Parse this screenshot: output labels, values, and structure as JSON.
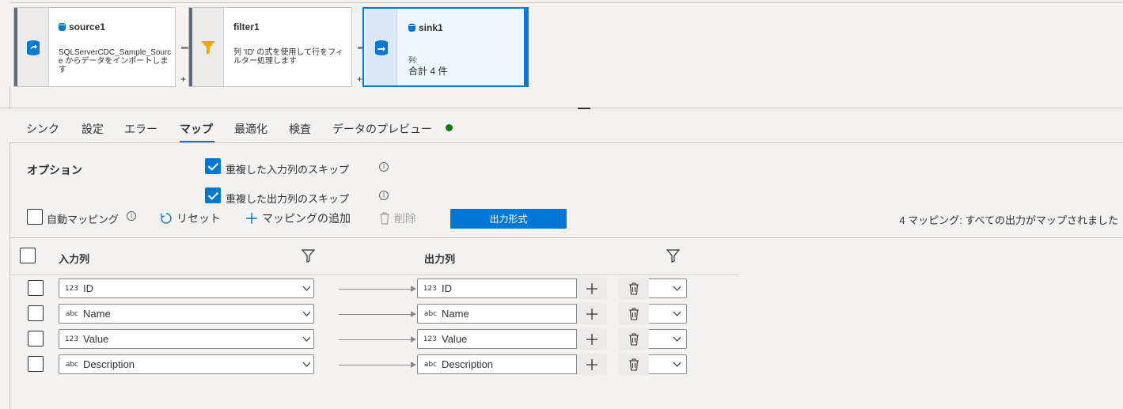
{
  "pipeline": {
    "nodes": [
      {
        "name": "source1",
        "desc": "SQLServerCDC_Sample_Source からデータをインポートします"
      },
      {
        "name": "filter1",
        "desc": "列 'ID' の式を使用して行をフィルター処理します"
      },
      {
        "name": "sink1",
        "desc_line1": "列:",
        "desc_line2": "合計 4 件"
      }
    ],
    "add_symbol": "+"
  },
  "tabs": [
    {
      "label": "シンク"
    },
    {
      "label": "設定"
    },
    {
      "label": "エラー"
    },
    {
      "label": "マップ",
      "active": true
    },
    {
      "label": "最適化"
    },
    {
      "label": "検査"
    },
    {
      "label": "データのプレビュー"
    }
  ],
  "options": {
    "title": "オプション",
    "skip_dup_input": {
      "label": "重複した入力列のスキップ",
      "checked": true
    },
    "skip_dup_output": {
      "label": "重複した出力列のスキップ",
      "checked": true
    },
    "info_glyph": "i"
  },
  "toolbar": {
    "auto_mapping": {
      "label": "自動マッピング",
      "checked": false
    },
    "reset": "リセット",
    "add_mapping": "マッピングの追加",
    "delete": "削除",
    "output_format": "出力形式",
    "status": "4 マッピング: すべての出力がマップされました"
  },
  "table": {
    "input_header": "入力列",
    "output_header": "出力列",
    "rows": [
      {
        "input_type": "123",
        "input": "ID",
        "output_type": "123",
        "output": "ID"
      },
      {
        "input_type": "abc",
        "input": "Name",
        "output_type": "abc",
        "output": "Name"
      },
      {
        "input_type": "123",
        "input": "Value",
        "output_type": "123",
        "output": "Value"
      },
      {
        "input_type": "abc",
        "input": "Description",
        "output_type": "abc",
        "output": "Description"
      }
    ]
  },
  "colors": {
    "accent": "#0078d4",
    "status_dot": "#107c10"
  }
}
